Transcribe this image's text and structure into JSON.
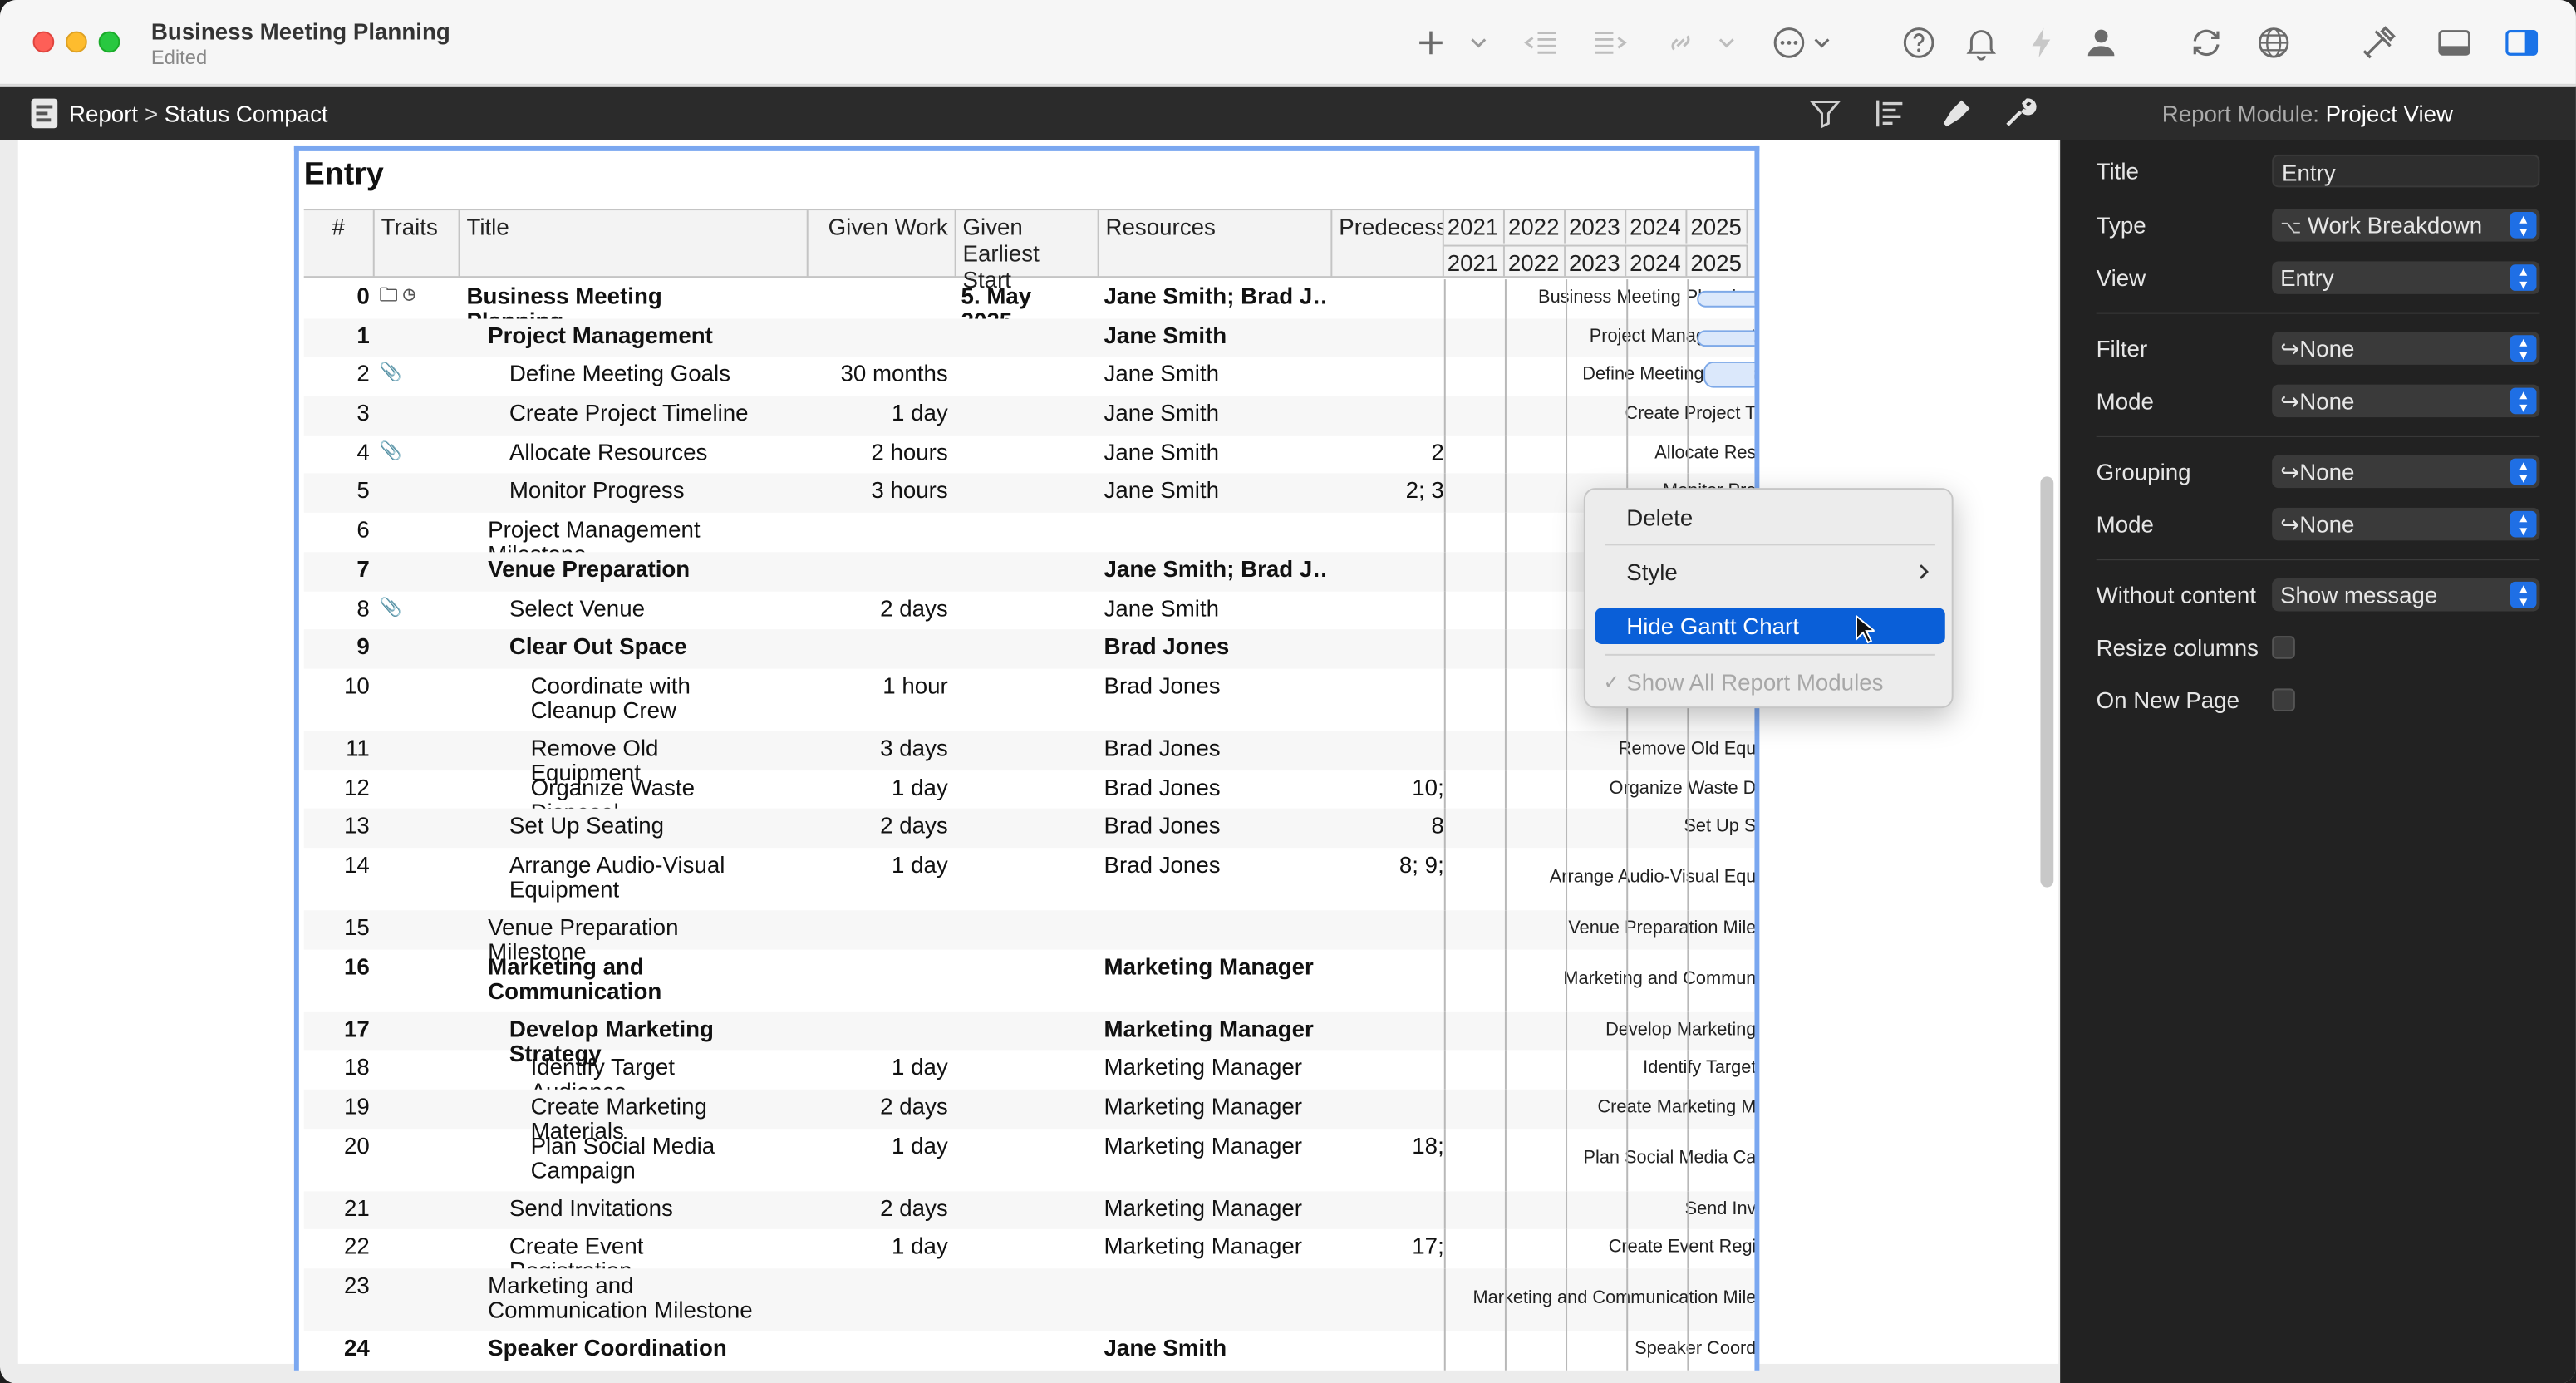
{
  "window": {
    "title": "Business Meeting Planning",
    "subtitle": "Edited"
  },
  "toolbar": {
    "icons": [
      "plus-icon",
      "chevron-down-icon",
      "outdent-icon",
      "indent-icon",
      "link-icon",
      "chevron-down-icon",
      "more-icon",
      "help-icon",
      "bell-icon",
      "bolt-icon",
      "person-icon",
      "sync-icon",
      "globe-icon",
      "tools-icon",
      "bottom-panel-icon",
      "right-panel-icon"
    ]
  },
  "subbar": {
    "crumb_report": "Report",
    "crumb_separator": ">",
    "crumb_status": "Status Compact",
    "inspector_prefix": "Report Module:",
    "inspector_name": "Project View"
  },
  "report": {
    "title": "Entry",
    "headers": {
      "num": "#",
      "traits": "Traits",
      "title": "Title",
      "given_work": "Given Work",
      "given_start": "Given Earliest Start",
      "resources": "Resources",
      "predecessors": "Predecess"
    },
    "years_top": [
      "2021",
      "2022",
      "2023",
      "2024",
      "2025"
    ],
    "years_bottom": [
      "2021",
      "2022",
      "2023",
      "2024",
      "2025"
    ],
    "rows": [
      {
        "num": "0",
        "traits": "🗀 ◷",
        "title": "Business Meeting Planning",
        "work": "",
        "start": "5. May 2025",
        "res": "Jane Smith; Brad J…",
        "pred": "",
        "gantt": "Business Meeting Planning",
        "bold": true,
        "indent": 0
      },
      {
        "num": "1",
        "traits": "",
        "title": "Project Management",
        "work": "",
        "start": "",
        "res": "Jane Smith",
        "pred": "",
        "gantt": "Project Management",
        "bold": true,
        "indent": 1
      },
      {
        "num": "2",
        "traits": "📎",
        "title": "Define Meeting Goals",
        "work": "30 months",
        "start": "",
        "res": "Jane Smith",
        "pred": "",
        "gantt": "Define Meeting Goals",
        "bold": false,
        "indent": 2
      },
      {
        "num": "3",
        "traits": "",
        "title": "Create Project Timeline",
        "work": "1 day",
        "start": "",
        "res": "Jane Smith",
        "pred": "",
        "gantt": "Create Project T",
        "bold": false,
        "indent": 2
      },
      {
        "num": "4",
        "traits": "📎",
        "title": "Allocate Resources",
        "work": "2 hours",
        "start": "",
        "res": "Jane Smith",
        "pred": "2",
        "gantt": "Allocate Res",
        "bold": false,
        "indent": 2
      },
      {
        "num": "5",
        "traits": "",
        "title": "Monitor Progress",
        "work": "3 hours",
        "start": "",
        "res": "Jane Smith",
        "pred": "2; 3",
        "gantt": "Monitor Pro",
        "bold": false,
        "indent": 2
      },
      {
        "num": "6",
        "traits": "",
        "title": "Project Management Milestone",
        "work": "",
        "start": "",
        "res": "",
        "pred": "",
        "gantt": "Projec",
        "bold": false,
        "indent": 1
      },
      {
        "num": "7",
        "traits": "",
        "title": "Venue Preparation",
        "work": "",
        "start": "",
        "res": "Jane Smith; Brad J…",
        "pred": "",
        "gantt": "",
        "bold": true,
        "indent": 1
      },
      {
        "num": "8",
        "traits": "📎",
        "title": "Select Venue",
        "work": "2 days",
        "start": "",
        "res": "Jane Smith",
        "pred": "",
        "gantt": "",
        "bold": false,
        "indent": 2
      },
      {
        "num": "9",
        "traits": "",
        "title": "Clear Out Space",
        "work": "",
        "start": "",
        "res": "Brad Jones",
        "pred": "",
        "gantt": "",
        "bold": true,
        "indent": 2
      },
      {
        "num": "10",
        "traits": "",
        "title": "Coordinate with Cleanup Crew",
        "work": "1 hour",
        "start": "",
        "res": "Brad Jones",
        "pred": "",
        "gantt": "C",
        "bold": false,
        "indent": 3,
        "tall": true
      },
      {
        "num": "11",
        "traits": "",
        "title": "Remove Old Equipment",
        "work": "3 days",
        "start": "",
        "res": "Brad Jones",
        "pred": "",
        "gantt": "Remove Old Equ",
        "bold": false,
        "indent": 3
      },
      {
        "num": "12",
        "traits": "",
        "title": "Organize Waste Disposal",
        "work": "1 day",
        "start": "",
        "res": "Brad Jones",
        "pred": "10;",
        "gantt": "Organize Waste D",
        "bold": false,
        "indent": 3
      },
      {
        "num": "13",
        "traits": "",
        "title": "Set Up Seating",
        "work": "2 days",
        "start": "",
        "res": "Brad Jones",
        "pred": "8",
        "gantt": "Set Up S",
        "bold": false,
        "indent": 2
      },
      {
        "num": "14",
        "traits": "",
        "title": "Arrange Audio-Visual Equipment",
        "work": "1 day",
        "start": "",
        "res": "Brad Jones",
        "pred": "8; 9;",
        "gantt": "Arrange Audio-Visual Equ",
        "bold": false,
        "indent": 2,
        "tall": true
      },
      {
        "num": "15",
        "traits": "",
        "title": "Venue Preparation Milestone",
        "work": "",
        "start": "",
        "res": "",
        "pred": "",
        "gantt": "Venue Preparation Mile",
        "bold": false,
        "indent": 1
      },
      {
        "num": "16",
        "traits": "",
        "title": "Marketing and Communication",
        "work": "",
        "start": "",
        "res": "Marketing Manager",
        "pred": "",
        "gantt": "Marketing and Commun",
        "bold": true,
        "indent": 1,
        "tall": true
      },
      {
        "num": "17",
        "traits": "",
        "title": "Develop Marketing Strategy",
        "work": "",
        "start": "",
        "res": "Marketing Manager",
        "pred": "",
        "gantt": "Develop Marketing",
        "bold": true,
        "indent": 2
      },
      {
        "num": "18",
        "traits": "",
        "title": "Identify Target Audience",
        "work": "1 day",
        "start": "",
        "res": "Marketing Manager",
        "pred": "",
        "gantt": "Identify Target",
        "bold": false,
        "indent": 3
      },
      {
        "num": "19",
        "traits": "",
        "title": "Create Marketing Materials",
        "work": "2 days",
        "start": "",
        "res": "Marketing Manager",
        "pred": "",
        "gantt": "Create Marketing M",
        "bold": false,
        "indent": 3
      },
      {
        "num": "20",
        "traits": "",
        "title": "Plan Social Media Campaign",
        "work": "1 day",
        "start": "",
        "res": "Marketing Manager",
        "pred": "18;",
        "gantt": "Plan Social Media Ca",
        "bold": false,
        "indent": 3,
        "tall": true
      },
      {
        "num": "21",
        "traits": "",
        "title": "Send Invitations",
        "work": "2 days",
        "start": "",
        "res": "Marketing Manager",
        "pred": "",
        "gantt": "Send Inv",
        "bold": false,
        "indent": 2
      },
      {
        "num": "22",
        "traits": "",
        "title": "Create Event Registration",
        "work": "1 day",
        "start": "",
        "res": "Marketing Manager",
        "pred": "17;",
        "gantt": "Create Event Regi",
        "bold": false,
        "indent": 2
      },
      {
        "num": "23",
        "traits": "",
        "title": "Marketing and Communication Milestone",
        "work": "",
        "start": "",
        "res": "",
        "pred": "",
        "gantt": "Marketing and Communication Mile",
        "bold": false,
        "indent": 1,
        "tall": true
      },
      {
        "num": "24",
        "traits": "",
        "title": "Speaker Coordination",
        "work": "",
        "start": "",
        "res": "Jane Smith",
        "pred": "",
        "gantt": "Speaker Coord",
        "bold": true,
        "indent": 1
      }
    ]
  },
  "context_menu": {
    "delete": "Delete",
    "style": "Style",
    "hide_gantt": "Hide Gantt Chart",
    "show_all": "Show All Report Modules"
  },
  "inspector": {
    "title_label": "Title",
    "title_value": "Entry",
    "type_label": "Type",
    "type_value": "Work Breakdown",
    "view_label": "View",
    "view_value": "Entry",
    "filter_label": "Filter",
    "filter_value": "↪None",
    "filter_mode_label": "Mode",
    "filter_mode_value": "↪None",
    "grouping_label": "Grouping",
    "grouping_value": "↪None",
    "grouping_mode_label": "Mode",
    "grouping_mode_value": "↪None",
    "without_content_label": "Without content",
    "without_content_value": "Show message",
    "resize_columns_label": "Resize columns",
    "on_new_page_label": "On New Page"
  },
  "colors": {
    "accent": "#0a5fd8",
    "selection_border": "#7aa7f0",
    "inspector_bg": "#222222"
  }
}
